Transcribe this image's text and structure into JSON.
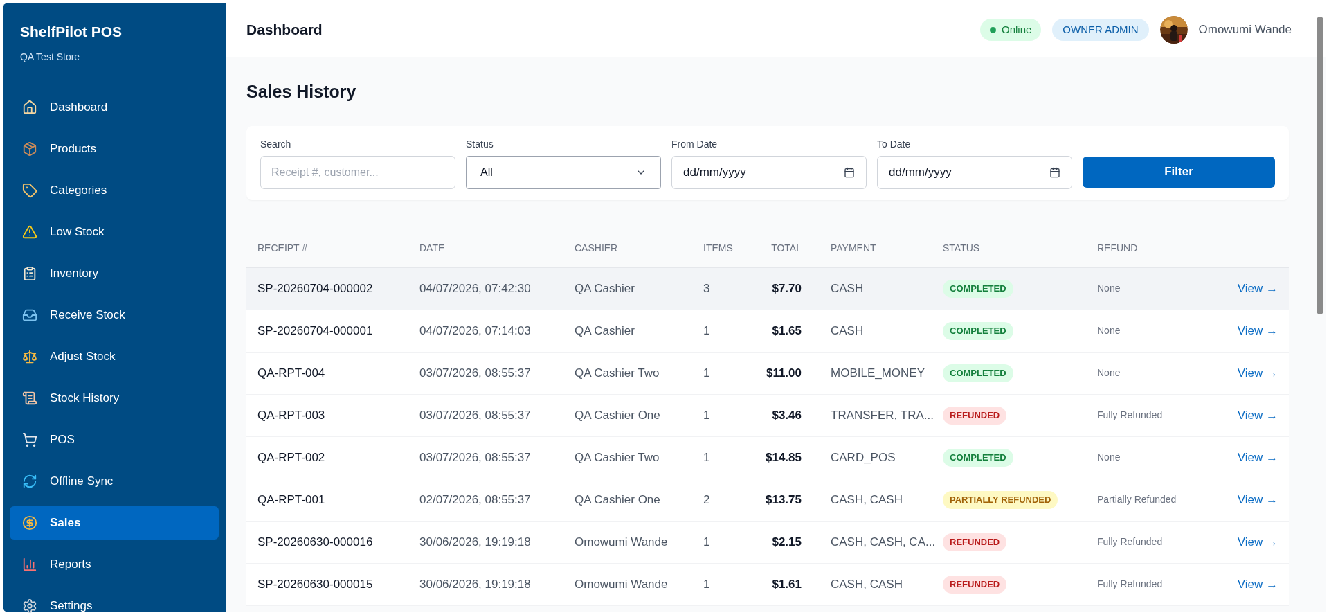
{
  "app": {
    "name": "ShelfPilot POS",
    "store": "QA Test Store"
  },
  "sidebar": {
    "items": [
      {
        "label": "Dashboard",
        "selected": false
      },
      {
        "label": "Products",
        "selected": false
      },
      {
        "label": "Categories",
        "selected": false
      },
      {
        "label": "Low Stock",
        "selected": false
      },
      {
        "label": "Inventory",
        "selected": false
      },
      {
        "label": "Receive Stock",
        "selected": false
      },
      {
        "label": "Adjust Stock",
        "selected": false
      },
      {
        "label": "Stock History",
        "selected": false
      },
      {
        "label": "POS",
        "selected": false
      },
      {
        "label": "Offline Sync",
        "selected": false
      },
      {
        "label": "Sales",
        "selected": true
      },
      {
        "label": "Reports",
        "selected": false
      },
      {
        "label": "Settings",
        "selected": false
      }
    ]
  },
  "header": {
    "title": "Dashboard",
    "status": "Online",
    "role": "OWNER ADMIN",
    "user": "Omowumi Wande"
  },
  "page_title": "Sales History",
  "filters": {
    "search": {
      "label": "Search",
      "placeholder": "Receipt #, customer..."
    },
    "status": {
      "label": "Status",
      "value": "All"
    },
    "from_date": {
      "label": "From Date",
      "value": "dd/mm/yyyy"
    },
    "to_date": {
      "label": "To Date",
      "value": "dd/mm/yyyy"
    },
    "button": "Filter"
  },
  "table": {
    "columns": [
      "RECEIPT #",
      "DATE",
      "CASHIER",
      "ITEMS",
      "TOTAL",
      "PAYMENT",
      "STATUS",
      "REFUND"
    ],
    "rows": [
      {
        "receipt": "SP-20260704-000002",
        "date": "04/07/2026, 07:42:30",
        "cashier": "QA Cashier",
        "items": "3",
        "total": "$7.70",
        "payment": "CASH",
        "status": {
          "label": "COMPLETED",
          "kind": "completed"
        },
        "refund": "None",
        "action": "View →",
        "hovered": true
      },
      {
        "receipt": "SP-20260704-000001",
        "date": "04/07/2026, 07:14:03",
        "cashier": "QA Cashier",
        "items": "1",
        "total": "$1.65",
        "payment": "CASH",
        "status": {
          "label": "COMPLETED",
          "kind": "completed"
        },
        "refund": "None",
        "action": "View →",
        "hovered": false
      },
      {
        "receipt": "QA-RPT-004",
        "date": "03/07/2026, 08:55:37",
        "cashier": "QA Cashier Two",
        "items": "1",
        "total": "$11.00",
        "payment": "MOBILE_MONEY",
        "status": {
          "label": "COMPLETED",
          "kind": "completed"
        },
        "refund": "None",
        "action": "View →",
        "hovered": false
      },
      {
        "receipt": "QA-RPT-003",
        "date": "03/07/2026, 08:55:37",
        "cashier": "QA Cashier One",
        "items": "1",
        "total": "$3.46",
        "payment": "TRANSFER, TRA...",
        "status": {
          "label": "REFUNDED",
          "kind": "refunded"
        },
        "refund": "Fully Refunded",
        "action": "View →",
        "hovered": false
      },
      {
        "receipt": "QA-RPT-002",
        "date": "03/07/2026, 08:55:37",
        "cashier": "QA Cashier Two",
        "items": "1",
        "total": "$14.85",
        "payment": "CARD_POS",
        "status": {
          "label": "COMPLETED",
          "kind": "completed"
        },
        "refund": "None",
        "action": "View →",
        "hovered": false
      },
      {
        "receipt": "QA-RPT-001",
        "date": "02/07/2026, 08:55:37",
        "cashier": "QA Cashier One",
        "items": "2",
        "total": "$13.75",
        "payment": "CASH, CASH",
        "status": {
          "label": "PARTIALLY REFUNDED",
          "kind": "partial"
        },
        "refund": "Partially Refunded",
        "action": "View →",
        "hovered": false
      },
      {
        "receipt": "SP-20260630-000016",
        "date": "30/06/2026, 19:19:18",
        "cashier": "Omowumi Wande",
        "items": "1",
        "total": "$2.15",
        "payment": "CASH, CASH, CA...",
        "status": {
          "label": "REFUNDED",
          "kind": "refunded"
        },
        "refund": "Fully Refunded",
        "action": "View →",
        "hovered": false
      },
      {
        "receipt": "SP-20260630-000015",
        "date": "30/06/2026, 19:19:18",
        "cashier": "Omowumi Wande",
        "items": "1",
        "total": "$1.61",
        "payment": "CASH, CASH",
        "status": {
          "label": "REFUNDED",
          "kind": "refunded"
        },
        "refund": "Fully Refunded",
        "action": "View →",
        "hovered": false
      }
    ]
  }
}
